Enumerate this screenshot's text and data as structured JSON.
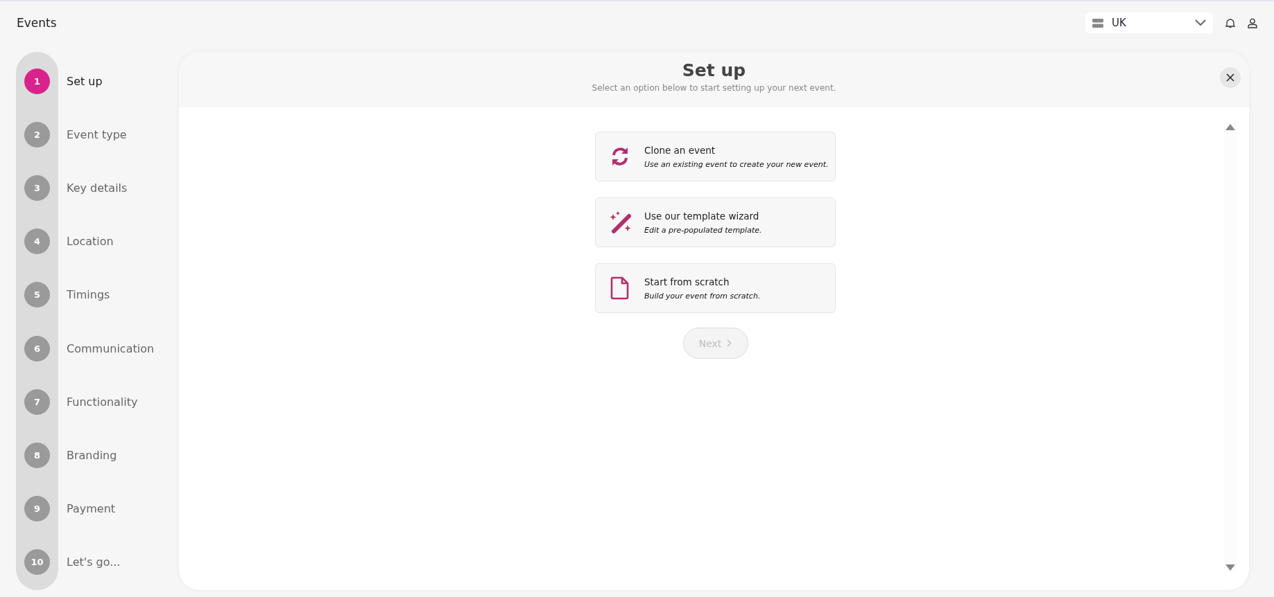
{
  "app_bar": {
    "title": "Events",
    "region": {
      "value": "UK"
    }
  },
  "steps": [
    {
      "number": "1",
      "label": "Set up",
      "selected": true
    },
    {
      "number": "2",
      "label": "Event type",
      "selected": false
    },
    {
      "number": "3",
      "label": "Key details",
      "selected": false
    },
    {
      "number": "4",
      "label": "Location",
      "selected": false
    },
    {
      "number": "5",
      "label": "Timings",
      "selected": false
    },
    {
      "number": "6",
      "label": "Communication",
      "selected": false
    },
    {
      "number": "7",
      "label": "Functionality",
      "selected": false
    },
    {
      "number": "8",
      "label": "Branding",
      "selected": false
    },
    {
      "number": "9",
      "label": "Payment",
      "selected": false
    },
    {
      "number": "10",
      "label": "Let's go...",
      "selected": false
    }
  ],
  "panel": {
    "title": "Set up",
    "subtitle": "Select an option below to start setting up your next event.",
    "options": [
      {
        "kind": "clone",
        "title": "Clone an event",
        "description": "Use an existing event to create your new event."
      },
      {
        "kind": "wizard",
        "title": "Use our template wizard",
        "description": "Edit a pre-populated template."
      },
      {
        "kind": "scratch",
        "title": "Start from scratch",
        "description": "Build your event from scratch."
      }
    ],
    "next_button": {
      "label": "Next",
      "disabled": true
    }
  }
}
